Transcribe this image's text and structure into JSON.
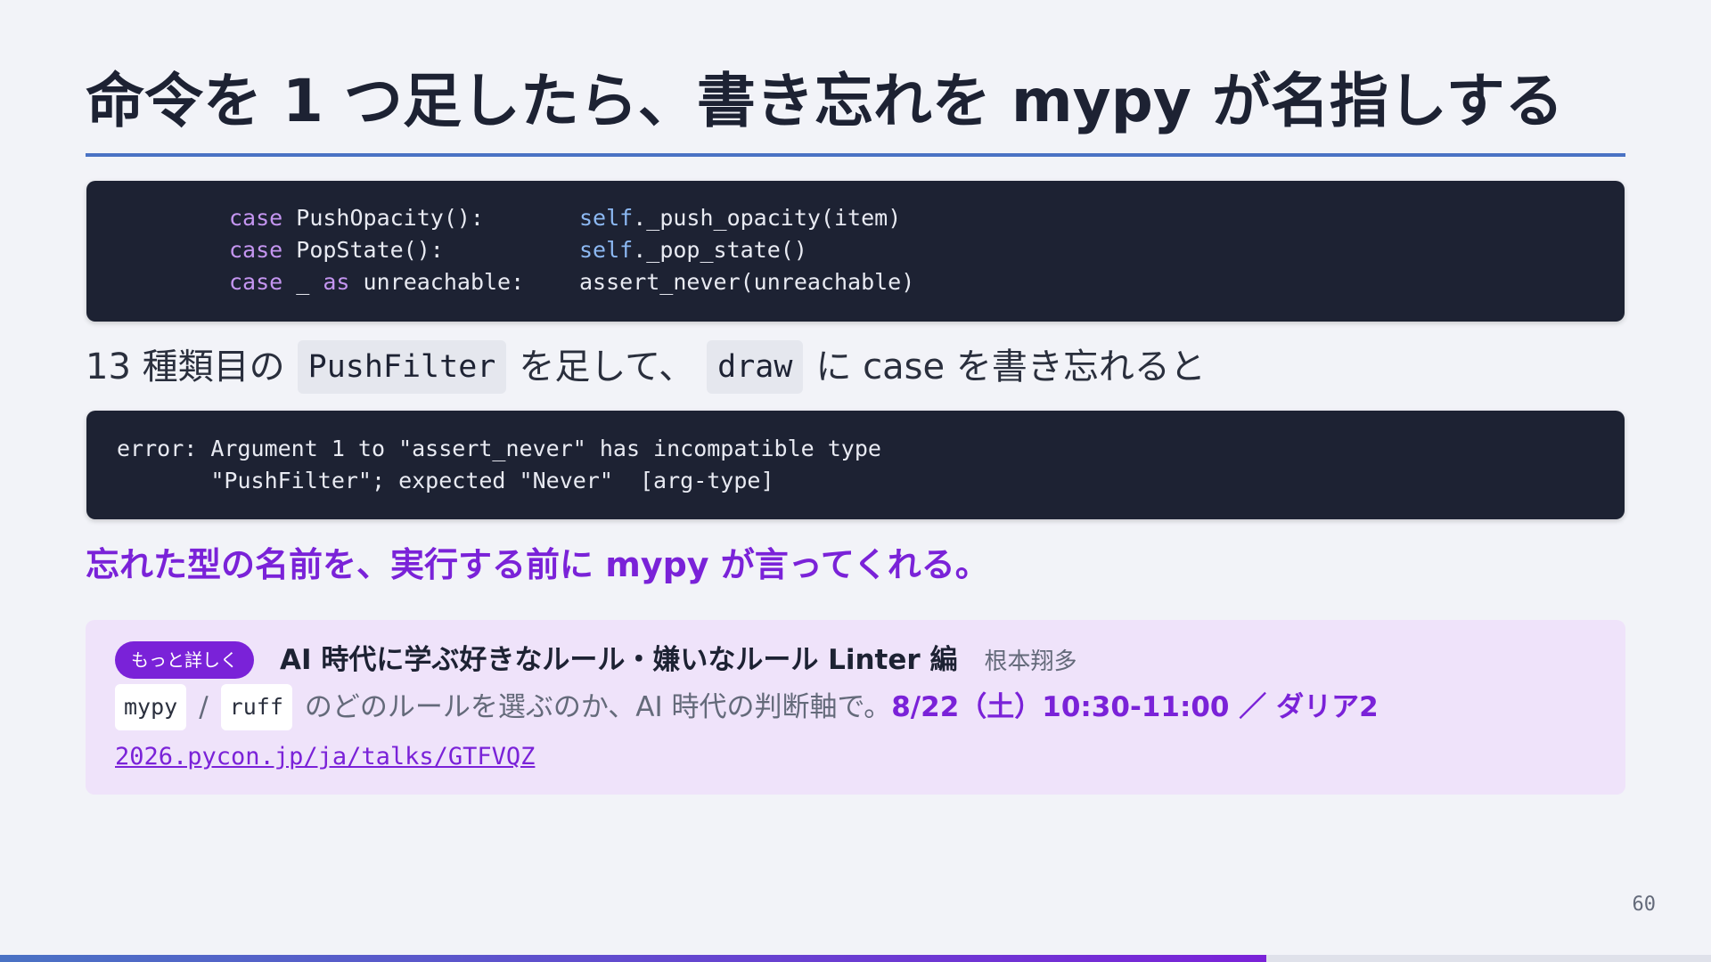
{
  "title": "命令を 1 つ足したら、書き忘れを mypy が名指しする",
  "code_block_1": {
    "lines": [
      {
        "kw": "case",
        "pattern": " PushOpacity():",
        "self": "self",
        "call": "._push_opacity(item)"
      },
      {
        "kw": "case",
        "pattern": " PopState():",
        "self": "self",
        "call": "._pop_state()"
      },
      {
        "kw": "case",
        "pattern_pre": " _ ",
        "kw2": "as",
        "pattern": " unreachable:",
        "call": "assert_never(unreachable)"
      }
    ]
  },
  "sentence": {
    "part1": "13 種類目の",
    "code1": "PushFilter",
    "part2": "を足して、",
    "code2": "draw",
    "part3": "に case を書き忘れると"
  },
  "code_block_2": {
    "lines": [
      "error: Argument 1 to \"assert_never\" has incompatible type",
      "       \"PushFilter\"; expected \"Never\"  [arg-type]"
    ]
  },
  "callout": "忘れた型の名前を、実行する前に mypy が言ってくれる。",
  "panel": {
    "badge": "もっと詳しく",
    "talk_title": "AI 時代に学ぶ好きなルール・嫌いなルール Linter 編",
    "speaker": "根本翔多",
    "chip1": "mypy",
    "slash": "/",
    "chip2": "ruff",
    "description": "のどのルールを選ぶのか、AI 時代の判断軸で。",
    "schedule": "8/22（土）10:30-11:00 ／ ダリア2",
    "url": "2026.pycon.jp/ja/talks/GTFVQZ"
  },
  "page_number": "60",
  "progress": 0.74,
  "colors": {
    "accent": "#7a22d8",
    "rule": "#4a72c4",
    "code_bg": "#1d2233",
    "panel_bg": "#efe3fa"
  }
}
